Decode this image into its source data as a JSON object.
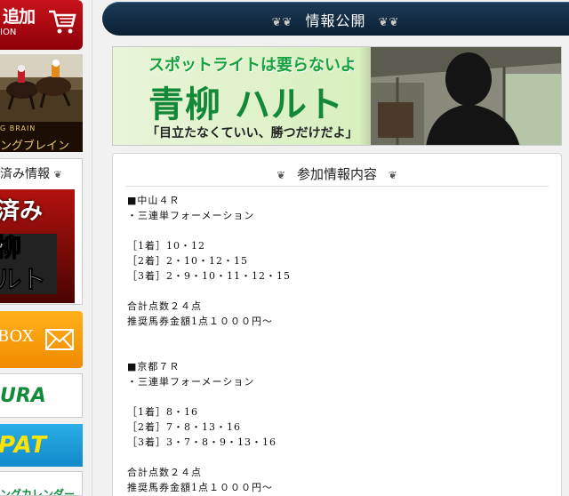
{
  "sidebar": {
    "cart_banner": {
      "line1": "追加",
      "line2": "ION"
    },
    "racing_banner": {
      "line1": "G BRAIN",
      "line2": "ングブレイン"
    },
    "used_info": {
      "heading": "済み情報",
      "banner_line1": "済み",
      "banner_line2": "柳",
      "banner_line3": "ルト"
    },
    "mail_banner": {
      "label": "BOX"
    },
    "jra_banner": {
      "label": "URA"
    },
    "ipat_banner": {
      "label": "PAT"
    },
    "calendar_banner": {
      "label": "ングカレンダー"
    }
  },
  "header": {
    "title": "情報公開"
  },
  "hero": {
    "tagline": "スポットライトは要らないよ",
    "name": "青柳 ハルト",
    "quote": "「目立たなくていい、勝つだけだよ」"
  },
  "info_card": {
    "heading": "参加情報内容",
    "lines": [
      "■中山４Ｒ",
      "・三連単フォーメーション",
      "",
      "［1着］10・12",
      "［2着］2・10・12・15",
      "［3着］2・9・10・11・12・15",
      "",
      "合計点数２４点",
      "推奨馬券金額1点１０００円〜",
      "",
      "",
      "■京都７Ｒ",
      "・三連単フォーメーション",
      "",
      "［1着］8・16",
      "［2着］7・8・13・16",
      "［3着］3・7・8・9・13・16",
      "",
      "合計点数２４点",
      "推奨馬券金額1点１０００円〜"
    ]
  },
  "colors": {
    "title_bar": "#0f2a42",
    "hero_green": "#128838",
    "cart_red": "#b3111a",
    "mail_orange": "#f7a00f",
    "jra_green": "#138a3a",
    "ipat_blue": "#1ea0dc"
  }
}
